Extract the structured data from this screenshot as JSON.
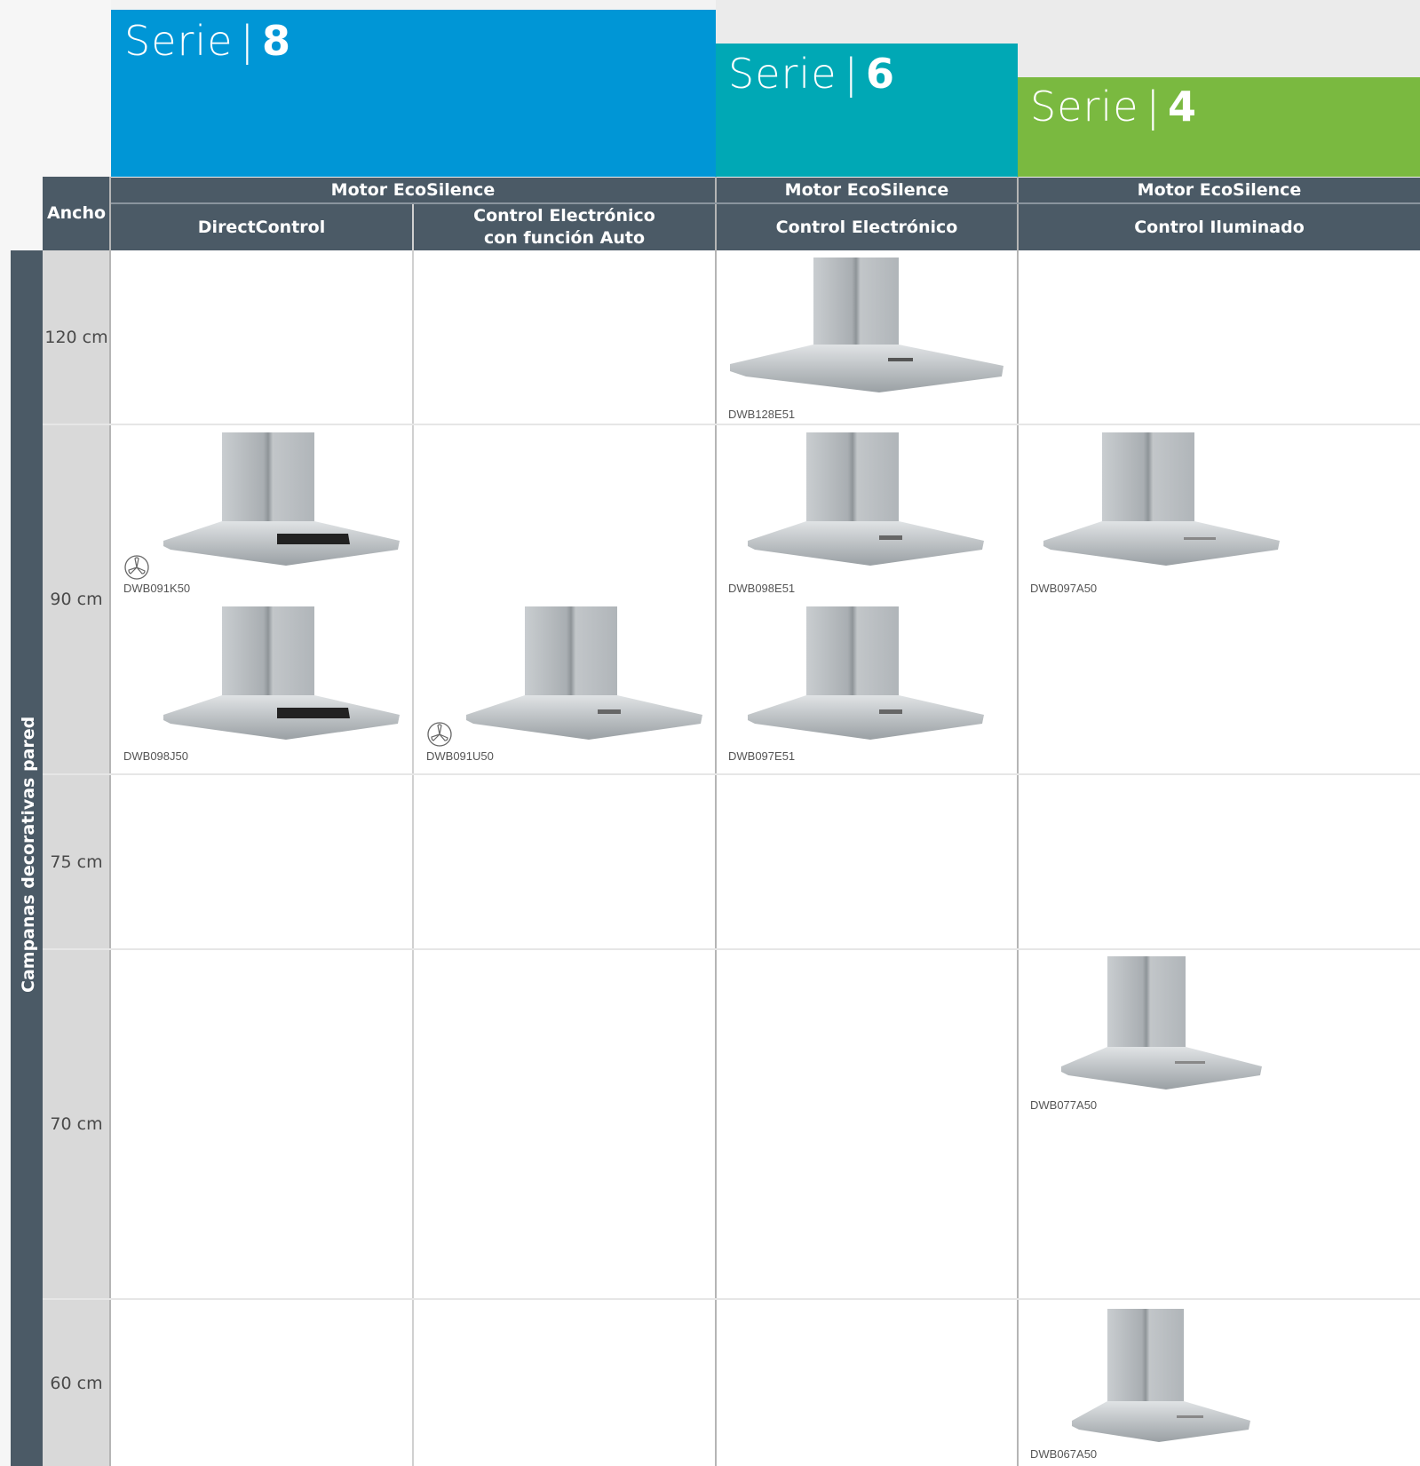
{
  "series": [
    {
      "word": "Serie",
      "sep": "|",
      "number": "8",
      "color": "#0096d6"
    },
    {
      "word": "Serie",
      "sep": "|",
      "number": "6",
      "color": "#00a8b5"
    },
    {
      "word": "Serie",
      "sep": "|",
      "number": "4",
      "color": "#7ab940"
    }
  ],
  "table": {
    "width_header": "Ancho",
    "side_label": "Campanas decorativas pared",
    "motor_headers": [
      "Motor EcoSilence",
      "Motor EcoSilence",
      "Motor EcoSilence"
    ],
    "control_headers": [
      "DirectControl",
      "Control Electrónico con función Auto",
      "Control Electrónico",
      "Control Iluminado"
    ],
    "widths": [
      "120 cm",
      "90 cm",
      "75 cm",
      "70 cm",
      "60 cm"
    ]
  },
  "products": [
    {
      "model": "DWB128E51",
      "icon": "hood-icon"
    },
    {
      "model": "DWB091K50",
      "icon": "hood-icon",
      "badge": "fan-icon"
    },
    {
      "model": "DWB098E51",
      "icon": "hood-icon"
    },
    {
      "model": "DWB097A50",
      "icon": "hood-icon"
    },
    {
      "model": "DWB098J50",
      "icon": "hood-icon"
    },
    {
      "model": "DWB091U50",
      "icon": "hood-icon",
      "badge": "fan-icon"
    },
    {
      "model": "DWB097E51",
      "icon": "hood-icon"
    },
    {
      "model": "DWB077A50",
      "icon": "hood-icon"
    },
    {
      "model": "DWB067A50",
      "icon": "hood-icon"
    }
  ]
}
